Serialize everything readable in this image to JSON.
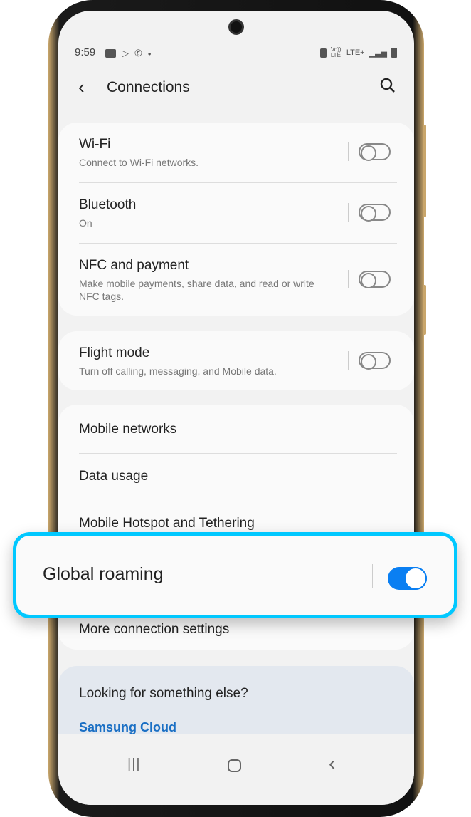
{
  "status_bar": {
    "time": "9:59",
    "left_icons": [
      "image-icon",
      "play-store-icon",
      "viber-icon",
      "dot"
    ],
    "right_icons": [
      "battery-saver-icon",
      "volte-icon",
      "lte-plus-icon",
      "signal-icon",
      "battery-icon"
    ],
    "volte": "Vo)) LTE",
    "lte": "LTE+"
  },
  "header": {
    "title": "Connections"
  },
  "groups": [
    [
      {
        "title": "Wi-Fi",
        "subtitle": "Connect to Wi-Fi networks.",
        "toggle": false
      },
      {
        "title": "Bluetooth",
        "subtitle": "On",
        "toggle": false
      },
      {
        "title": "NFC and payment",
        "subtitle": "Make mobile payments, share data, and read or write NFC tags.",
        "toggle": false
      }
    ],
    [
      {
        "title": "Flight mode",
        "subtitle": "Turn off calling, messaging, and Mobile data.",
        "toggle": false
      }
    ],
    [
      {
        "title": "Mobile networks"
      },
      {
        "title": "Data usage"
      },
      {
        "title": "Mobile Hotspot and Tethering"
      },
      {
        "title": "More connection settings"
      }
    ]
  ],
  "suggest": {
    "title": "Looking for something else?",
    "link": "Samsung Cloud"
  },
  "highlight": {
    "title": "Global roaming",
    "toggle": true
  },
  "colors": {
    "accent": "#0a7ff2",
    "highlight_border": "#00c8ff",
    "link": "#1a6fc4"
  }
}
